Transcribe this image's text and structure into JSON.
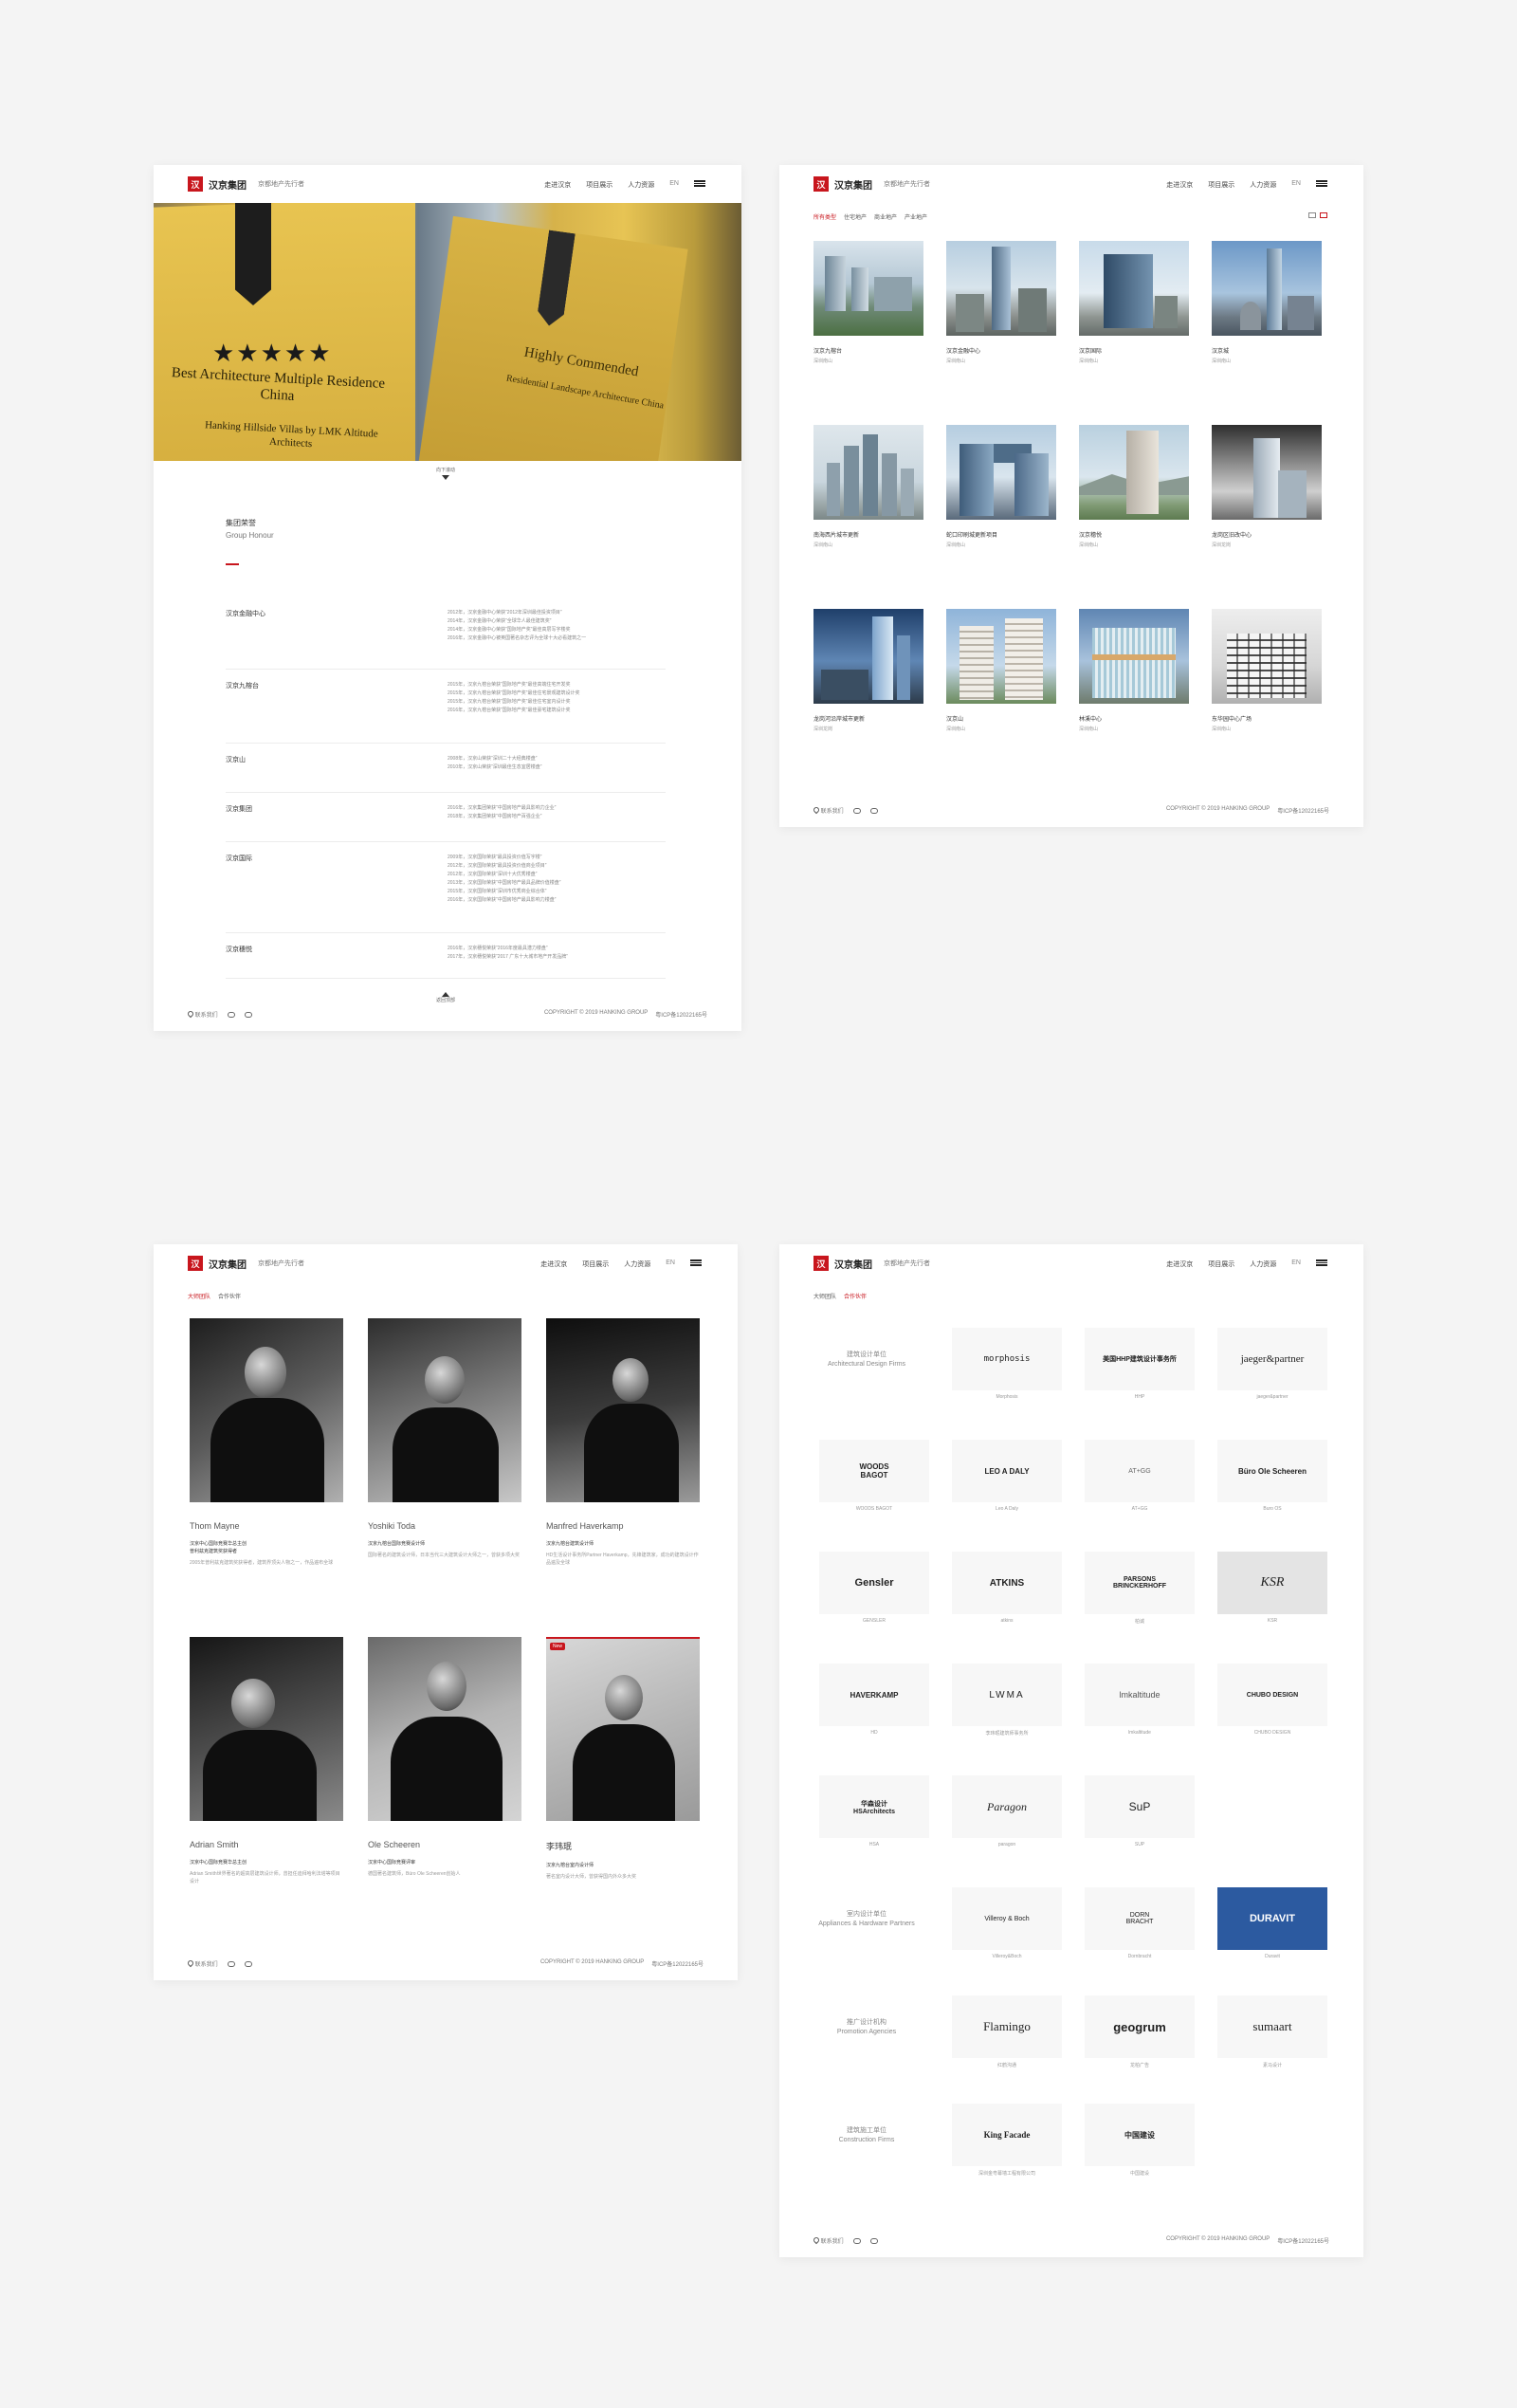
{
  "header": {
    "logo_mark": "汉",
    "logo_text": "汉京集团",
    "slogan": "京都地产先行者",
    "nav": [
      "走进汉京",
      "项目展示",
      "人力资源"
    ],
    "lang": "EN"
  },
  "footer": {
    "contact": "联系我们",
    "copyright": "COPYRIGHT © 2019 HANKING GROUP",
    "icp": "粤ICP备12022165号"
  },
  "honours": {
    "hero": {
      "stars": "★★★★★",
      "award_main": "Best Architecture Multiple Residence China",
      "award_sub": "Hanking Hillside Villas by LMK Altitude Architects",
      "award_right": "Highly Commended",
      "award_right_sub": "Residential Landscape Architecture China"
    },
    "scroll_label": "向下滚动",
    "title": "集团荣誉",
    "subtitle": "Group Honour",
    "rows": [
      {
        "name": "汉京金融中心",
        "items": [
          "2012年，汉京金融中心荣获“2012年深圳最佳投资项目”",
          "2014年，汉京金融中心荣获“全球华人最佳建筑奖”",
          "2014年，汉京金融中心荣获“国际地产奖”最佳高层写字楼奖",
          "2016年，汉京金融中心被英国著名杂志评为全球十大必看建筑之一"
        ]
      },
      {
        "name": "汉京九榕台",
        "items": [
          "2015年，汉京九榕台荣获“国际地产奖”最佳高端住宅开发奖",
          "2015年，汉京九榕台荣获“国际地产奖”最佳住宅景观建筑设计奖",
          "2015年，汉京九榕台荣获“国际地产奖”最佳住宅室内设计奖",
          "2016年，汉京九榕台荣获“国际地产奖”最佳豪宅建筑设计奖"
        ]
      },
      {
        "name": "汉京山",
        "items": [
          "2008年，汉京山荣获“深圳二十大经典楼盘”",
          "2010年，汉京山荣获“深圳最佳生态宜居楼盘”"
        ]
      },
      {
        "name": "汉京集团",
        "items": [
          "2016年，汉京集团荣获“中国房地产最具影响力企业”",
          "2018年，汉京集团荣获“中国房地产百强企业”"
        ]
      },
      {
        "name": "汉京国际",
        "items": [
          "2009年，汉京国际荣获“最具投资价值写字楼”",
          "2012年，汉京国际荣获“最具投资价值商业项目”",
          "2012年，汉京国际荣获“深圳十大优秀楼盘”",
          "2013年，汉京国际荣获“中国房地产最具品牌价值楼盘”",
          "2015年，汉京国际荣获“深圳市优秀商业综合体”",
          "2016年，汉京国际荣获“中国房地产最具影响力楼盘”"
        ]
      },
      {
        "name": "汉京穗悦",
        "items": [
          "2016年，汉京穗悦荣获“2016年度最具潜力楼盘”",
          "2017年，汉京穗悦荣获“2017 广东十大城市地产开发品牌”"
        ]
      }
    ],
    "back_top": "返回顶部"
  },
  "projects": {
    "tabs": [
      "所有类型",
      "住宅地产",
      "商业地产",
      "产业地产"
    ],
    "items": [
      {
        "name": "汉京九榕台",
        "loc": "深圳南山"
      },
      {
        "name": "汉京金融中心",
        "loc": "深圳南山"
      },
      {
        "name": "汉京国际",
        "loc": "深圳南山"
      },
      {
        "name": "汉京城",
        "loc": "深圳南山"
      },
      {
        "name": "南海西片城市更新",
        "loc": "深圳南山"
      },
      {
        "name": "蛇口印刷城更新项目",
        "loc": "深圳南山"
      },
      {
        "name": "汉京穗悦",
        "loc": "深圳南山"
      },
      {
        "name": "龙岗区旧改中心",
        "loc": "深圳龙岗"
      },
      {
        "name": "龙岗河沿岸城市更新",
        "loc": "深圳龙岗"
      },
      {
        "name": "汉京山",
        "loc": "深圳南山"
      },
      {
        "name": "林溪中心",
        "loc": "深圳南山"
      },
      {
        "name": "东华园中心广场",
        "loc": "深圳南山"
      }
    ]
  },
  "team": {
    "tabs": [
      "大师团队",
      "合作伙伴"
    ],
    "people": [
      {
        "name": "Thom Mayne",
        "title": "汉京中心国际竞赛华总主创\n普利兹克建筑奖获得者",
        "desc": "2005年普利兹克建筑奖获得者，建筑界顶尖人物之一，作品遍布全球"
      },
      {
        "name": "Yoshiki Toda",
        "title": "汉京九榕台国际竞赛设计师",
        "desc": "国际著名的建筑设计师，日本当代三大建筑设计大师之一，曾获多项大奖"
      },
      {
        "name": "Manfred Haverkamp",
        "title": "汉京九榕台建筑设计师",
        "desc": "HD生活设计事务所Partner Haverkamp，先锋建筑家，成功的建筑设计作品遍及全球"
      },
      {
        "name": "Adrian Smith",
        "title": "汉京中心国际竞赛华总主创",
        "desc": "Adrian Smith世界著名的超高层建筑设计师，曾担任迪拜哈利法塔等项目设计"
      },
      {
        "name": "Ole Scheeren",
        "title": "汉京中心国际竞赛评审",
        "desc": "德国著名建筑师，Büro Ole Scheeren创始人"
      },
      {
        "name": "李玮珉",
        "title": "汉京九榕台室内设计师",
        "desc": "著名室内设计大师，曾获得国内外众多大奖",
        "tag": "New"
      }
    ]
  },
  "partners": {
    "tabs": [
      "大师团队",
      "合作伙伴"
    ],
    "groups": [
      {
        "cat": "建筑设计单位\nArchitectural Design Firms"
      },
      {
        "cat": "室内设计单位\nAppliances & Hardware Partners"
      },
      {
        "cat": "推广设计机构\nPromotion Agencies"
      },
      {
        "cat": "建筑施工单位\nConstruction Firms"
      }
    ],
    "logos": [
      {
        "logo": "morphosis",
        "cap": "Morphosis"
      },
      {
        "logo": "美国HHP建筑设计事务所",
        "cap": "HHP"
      },
      {
        "logo": "jaeger&partner",
        "cap": "jaeger&partner"
      },
      {
        "logo": "WOODS BAGOT",
        "cap": "WOODS BAGOT"
      },
      {
        "logo": "LEO A DALY",
        "cap": "Leo A Daly"
      },
      {
        "logo": "AT+GG",
        "cap": "AT+GG"
      },
      {
        "logo": "Büro Ole Scheeren",
        "cap": "Buro OS"
      },
      {
        "logo": "Gensler",
        "cap": "GENSLER"
      },
      {
        "logo": "ATKINS",
        "cap": "atkins"
      },
      {
        "logo": "PARSONS BRINCKERHOFF",
        "cap": "柏诚"
      },
      {
        "logo": "KSR",
        "cap": "KSR"
      },
      {
        "logo": "HAVERKAMP",
        "cap": "HD"
      },
      {
        "logo": "LWMA",
        "cap": "李玮珉建筑师事务所"
      },
      {
        "logo": "lmkaltitude",
        "cap": "lmkaltitude"
      },
      {
        "logo": "CHUBO DESIGN",
        "cap": "CHUBO DESIGN"
      },
      {
        "logo": "华森设计 HSArchitects",
        "cap": "HSA"
      },
      {
        "logo": "Paragon",
        "cap": "paragon"
      },
      {
        "logo": "SuP",
        "cap": "SUP"
      },
      {
        "logo": "Villeroy & Boch",
        "cap": "Villeroy&Boch"
      },
      {
        "logo": "DORN BRACHT",
        "cap": "Dornbracht"
      },
      {
        "logo": "DURAVIT",
        "cap": "Duravit"
      },
      {
        "logo": "Flamingo",
        "cap": "红鹤沟通"
      },
      {
        "logo": "geogrum",
        "cap": "龙柏广告"
      },
      {
        "logo": "sumaart",
        "cap": "素马设计"
      },
      {
        "logo": "King Facade",
        "cap": "深圳金粤幕墙工程有限公司"
      },
      {
        "logo": "中国建设",
        "cap": "中国建设"
      }
    ]
  },
  "colors": {
    "accent": "#c8161d",
    "duravit": "#2c5aa0"
  }
}
